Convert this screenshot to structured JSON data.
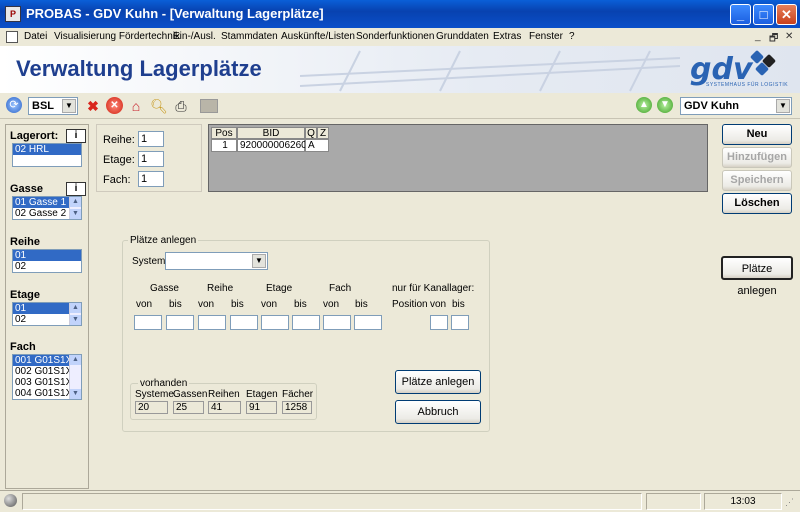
{
  "window": {
    "title": "PROBAS - GDV Kuhn - [Verwaltung Lagerplätze]",
    "app_icon": "probas-app-icon",
    "controls": [
      "_",
      "□",
      "✕"
    ]
  },
  "menu": {
    "items": [
      "Datei",
      "Visualisierung Fördertechnik",
      "Ein-/Ausl.",
      "Stammdaten",
      "Auskünfte/Listen",
      "Sonderfunktionen",
      "Grunddaten",
      "Extras",
      "Fenster",
      "?"
    ],
    "mdi_controls": [
      "_",
      "🗗",
      "✕"
    ]
  },
  "banner": {
    "title": "Verwaltung Lagerplätze",
    "logo": "gdv",
    "logo_sub": "SYSTEMHAUS FÜR LOGISTIK"
  },
  "toolbar": {
    "system_value": "BSL",
    "user_value": "GDV Kuhn",
    "arrow": "▼"
  },
  "left": {
    "lagerort_label": "Lagerort:",
    "lagerort_items": [
      "02 HRL"
    ],
    "gasse_label": "Gasse",
    "gasse_items": [
      "01 Gasse 1",
      "02 Gasse 2"
    ],
    "reihe_label": "Reihe",
    "reihe_items": [
      "01",
      "02"
    ],
    "etage_label": "Etage",
    "etage_items": [
      "01",
      "02"
    ],
    "fach_label": "Fach",
    "fach_items": [
      "001 G01S1X",
      "002 G01S1X",
      "003 G01S1X",
      "004 G01S1X"
    ],
    "info": "i"
  },
  "topform": {
    "reihe_label": "Reihe:",
    "reihe_value": "1",
    "etage_label": "Etage:",
    "etage_value": "1",
    "fach_label": "Fach:",
    "fach_value": "1"
  },
  "grid": {
    "headers": [
      "Pos",
      "BID",
      "Q",
      "Z"
    ],
    "rows": [
      [
        "1",
        "920000006260",
        "A",
        ""
      ]
    ]
  },
  "buttons": {
    "neu": "Neu",
    "hinzufuegen": "Hinzufügen",
    "speichern": "Speichern",
    "loeschen": "Löschen",
    "plaetze_anlegen": "Plätze anlegen"
  },
  "group": {
    "title": "Plätze anlegen",
    "system_label": "System",
    "col_gasse": "Gasse",
    "col_reihe": "Reihe",
    "col_etage": "Etage",
    "col_fach": "Fach",
    "col_kanal": "nur für Kanallager:",
    "von": "von",
    "bis": "bis",
    "position": "Position",
    "vorhanden": "vorhanden",
    "v_systeme": "Systeme",
    "v_systeme_val": "20",
    "v_gassen": "Gassen",
    "v_gassen_val": "25",
    "v_reihen": "Reihen",
    "v_reihen_val": "41",
    "v_etagen": "Etagen",
    "v_etagen_val": "91",
    "v_faecher": "Fächer",
    "v_faecher_val": "1258",
    "btn_anlegen": "Plätze anlegen",
    "btn_abbruch": "Abbruch"
  },
  "status": {
    "time": "13:03"
  }
}
